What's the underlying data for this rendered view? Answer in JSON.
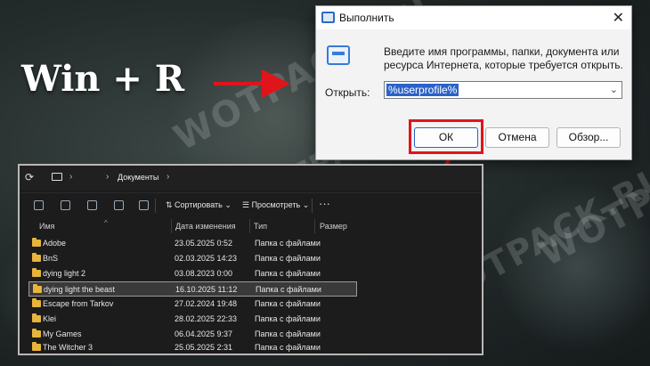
{
  "hotkey_caption": "Win + R",
  "watermark_text": "WOTPACK.RU",
  "run_dialog": {
    "title": "Выполнить",
    "description": "Введите имя программы, папки, документа или ресурса Интернета, которые требуется открыть.",
    "open_label": "Открыть:",
    "open_value": "%userprofile%",
    "ok_label": "ОК",
    "cancel_label": "Отмена",
    "browse_label": "Обзор...",
    "close_glyph": "✕"
  },
  "explorer": {
    "breadcrumb": "Документы",
    "toolbar": {
      "sort_label": "Сортировать",
      "view_label": "Просмотреть",
      "more_glyph": "···"
    },
    "columns": [
      "Имя",
      "Дата изменения",
      "Тип",
      "Размер"
    ],
    "rows": [
      {
        "name": "Adobe",
        "date": "23.05.2025 0:52",
        "type": "Папка с файлами",
        "selected": false
      },
      {
        "name": "BnS",
        "date": "02.03.2025 14:23",
        "type": "Папка с файлами",
        "selected": false
      },
      {
        "name": "dying light 2",
        "date": "03.08.2023 0:00",
        "type": "Папка с файлами",
        "selected": false
      },
      {
        "name": "dying light the beast",
        "date": "16.10.2025 11:12",
        "type": "Папка с файлами",
        "selected": true
      },
      {
        "name": "Escape from Tarkov",
        "date": "27.02.2024 19:48",
        "type": "Папка с файлами",
        "selected": false
      },
      {
        "name": "Klei",
        "date": "28.02.2025 22:33",
        "type": "Папка с файлами",
        "selected": false
      },
      {
        "name": "My Games",
        "date": "06.04.2025 9:37",
        "type": "Папка с файлами",
        "selected": false
      },
      {
        "name": "The Witcher 3",
        "date": "25.05.2025 2:31",
        "type": "Папка с файлами",
        "selected": false
      }
    ]
  },
  "colors": {
    "highlight_red": "#e0141b",
    "selection_blue": "#2a62c9",
    "folder_yellow": "#e8b53c"
  }
}
